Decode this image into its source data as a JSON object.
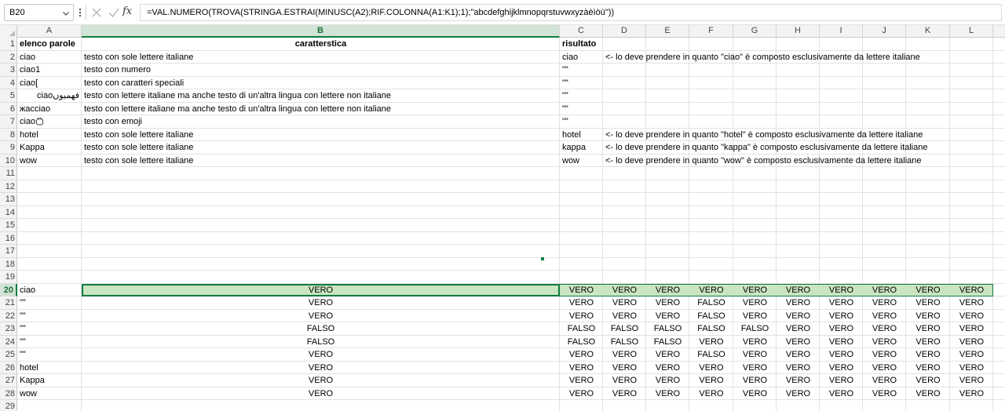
{
  "formula_bar": {
    "name_box": "B20",
    "formula": "=VAL.NUMERO(TROVA(STRINGA.ESTRAI(MINUSC(A2);RIF.COLONNA(A1:K1);1);\"abcdefghijklmnopqrstuvwxyzàèìòù\"))",
    "fx_label": "fx"
  },
  "columns": [
    "A",
    "B",
    "C",
    "D",
    "E",
    "F",
    "G",
    "H",
    "I",
    "J",
    "K",
    "L"
  ],
  "row_numbers": [
    "1",
    "2",
    "3",
    "4",
    "5",
    "6",
    "7",
    "8",
    "9",
    "10",
    "11",
    "12",
    "13",
    "14",
    "15",
    "16",
    "17",
    "18",
    "19",
    "20",
    "21",
    "22",
    "23",
    "24",
    "25",
    "26",
    "27",
    "28",
    "29"
  ],
  "selection": {
    "column": "B",
    "row": "20"
  },
  "header_row": {
    "a": "elenco parole",
    "b": "caratterstica",
    "c": "risultato"
  },
  "upper_rows": [
    {
      "a": "ciao",
      "b": "testo con sole lettere italiane",
      "c": "ciao",
      "d": "<- lo deve prendere in quanto \"ciao\" è composto esclusivamente da lettere italiane"
    },
    {
      "a": "ciao1",
      "b": "testo con numero",
      "c": "\"\"",
      "d": ""
    },
    {
      "a": "ciao[",
      "b": "testo con caratteri speciali",
      "c": "\"\"",
      "d": ""
    },
    {
      "a": "ciaoفهمیوں",
      "b": "testo con lettere italiane ma anche testo di un'altra lingua con lettere non italiane",
      "c": "\"\"",
      "d": ""
    },
    {
      "a": "жасciao",
      "b": "testo con lettere italiane ma anche testo di un'altra lingua con lettere non italiane",
      "c": "\"\"",
      "d": ""
    },
    {
      "a": "ciao",
      "b": "testo con emoji",
      "c": "\"\"",
      "d": ""
    },
    {
      "a": "hotel",
      "b": "testo con sole lettere italiane",
      "c": "hotel",
      "d": "<- lo deve prendere in quanto \"hotel\" è composto esclusivamente da lettere italiane"
    },
    {
      "a": "Kappa",
      "b": "testo con sole lettere italiane",
      "c": "kappa",
      "d": "<- lo deve prendere in quanto \"kappa\" è composto esclusivamente da lettere italiane"
    },
    {
      "a": "wow",
      "b": "testo con sole lettere italiane",
      "c": "wow",
      "d": "<- lo deve prendere in quanto \"wow\" è composto esclusivamente da lettere italiane"
    }
  ],
  "lower_rows": [
    {
      "a": "ciao",
      "vals": [
        "VERO",
        "VERO",
        "VERO",
        "VERO",
        "VERO",
        "VERO",
        "VERO",
        "VERO",
        "VERO",
        "VERO",
        "VERO"
      ]
    },
    {
      "a": "\"\"",
      "vals": [
        "VERO",
        "VERO",
        "VERO",
        "VERO",
        "FALSO",
        "VERO",
        "VERO",
        "VERO",
        "VERO",
        "VERO",
        "VERO"
      ]
    },
    {
      "a": "\"\"",
      "vals": [
        "VERO",
        "VERO",
        "VERO",
        "VERO",
        "FALSO",
        "VERO",
        "VERO",
        "VERO",
        "VERO",
        "VERO",
        "VERO"
      ]
    },
    {
      "a": "\"\"",
      "vals": [
        "FALSO",
        "FALSO",
        "FALSO",
        "FALSO",
        "FALSO",
        "FALSO",
        "VERO",
        "VERO",
        "VERO",
        "VERO",
        "VERO"
      ]
    },
    {
      "a": "\"\"",
      "vals": [
        "FALSO",
        "FALSO",
        "FALSO",
        "FALSO",
        "VERO",
        "VERO",
        "VERO",
        "VERO",
        "VERO",
        "VERO",
        "VERO"
      ]
    },
    {
      "a": "\"\"",
      "vals": [
        "VERO",
        "VERO",
        "VERO",
        "VERO",
        "FALSO",
        "VERO",
        "VERO",
        "VERO",
        "VERO",
        "VERO",
        "VERO"
      ]
    },
    {
      "a": "hotel",
      "vals": [
        "VERO",
        "VERO",
        "VERO",
        "VERO",
        "VERO",
        "VERO",
        "VERO",
        "VERO",
        "VERO",
        "VERO",
        "VERO"
      ]
    },
    {
      "a": "Kappa",
      "vals": [
        "VERO",
        "VERO",
        "VERO",
        "VERO",
        "VERO",
        "VERO",
        "VERO",
        "VERO",
        "VERO",
        "VERO",
        "VERO"
      ]
    },
    {
      "a": "wow",
      "vals": [
        "VERO",
        "VERO",
        "VERO",
        "VERO",
        "VERO",
        "VERO",
        "VERO",
        "VERO",
        "VERO",
        "VERO",
        "VERO"
      ]
    }
  ],
  "icons": {
    "name_box_dropdown": "chevron-down-icon",
    "more": "more-vertical-icon",
    "cancel": "close-icon",
    "enter": "check-icon",
    "function": "fx-icon",
    "emoji": "emoji-icon"
  },
  "colors": {
    "accent": "#107c41",
    "selection_fill": "#c9e5c1",
    "header_bg": "#f3f3f3"
  }
}
